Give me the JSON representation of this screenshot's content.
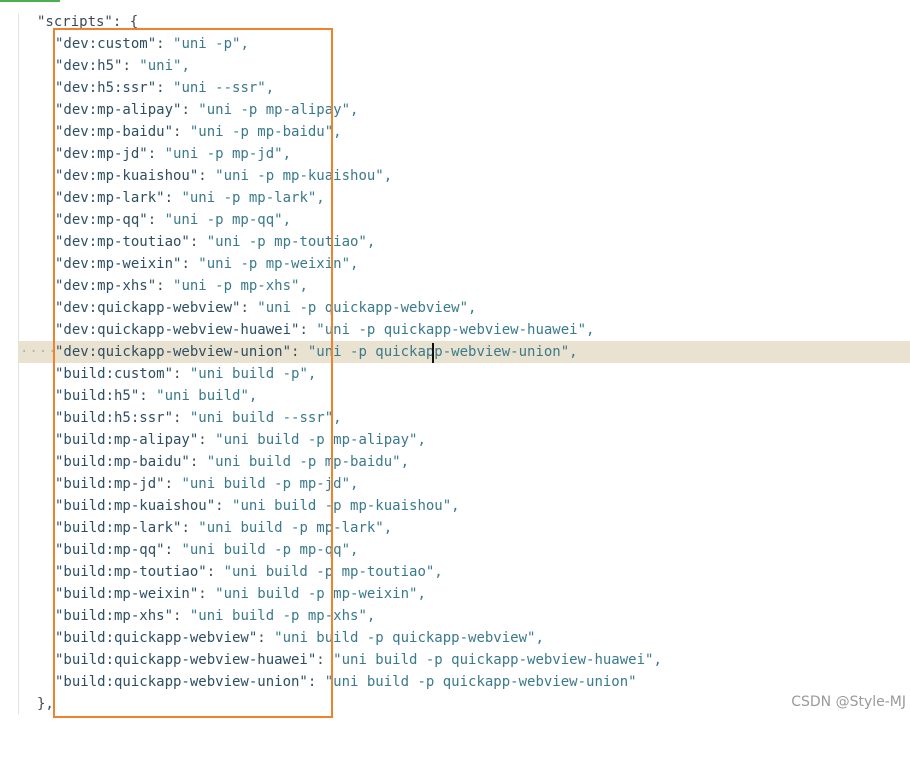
{
  "editor": {
    "open_line": "\"scripts\": {",
    "close_line": "},",
    "whitespace_marker": "····",
    "current_line_index": 14,
    "entries": [
      {
        "key": "\"dev:custom\"",
        "value": "\"uni -p\","
      },
      {
        "key": "\"dev:h5\"",
        "value": "\"uni\","
      },
      {
        "key": "\"dev:h5:ssr\"",
        "value": "\"uni --ssr\","
      },
      {
        "key": "\"dev:mp-alipay\"",
        "value": "\"uni -p mp-alipay\","
      },
      {
        "key": "\"dev:mp-baidu\"",
        "value": "\"uni -p mp-baidu\","
      },
      {
        "key": "\"dev:mp-jd\"",
        "value": "\"uni -p mp-jd\","
      },
      {
        "key": "\"dev:mp-kuaishou\"",
        "value": "\"uni -p mp-kuaishou\","
      },
      {
        "key": "\"dev:mp-lark\"",
        "value": "\"uni -p mp-lark\","
      },
      {
        "key": "\"dev:mp-qq\"",
        "value": "\"uni -p mp-qq\","
      },
      {
        "key": "\"dev:mp-toutiao\"",
        "value": "\"uni -p mp-toutiao\","
      },
      {
        "key": "\"dev:mp-weixin\"",
        "value": "\"uni -p mp-weixin\","
      },
      {
        "key": "\"dev:mp-xhs\"",
        "value": "\"uni -p mp-xhs\","
      },
      {
        "key": "\"dev:quickapp-webview\"",
        "value": "\"uni -p quickapp-webview\","
      },
      {
        "key": "\"dev:quickapp-webview-huawei\"",
        "value": "\"uni -p quickapp-webview-huawei\","
      },
      {
        "key": "\"dev:quickapp-webview-union\"",
        "value": "\"uni -p quickapp-webview-union\","
      },
      {
        "key": "\"build:custom\"",
        "value": "\"uni build -p\","
      },
      {
        "key": "\"build:h5\"",
        "value": "\"uni build\","
      },
      {
        "key": "\"build:h5:ssr\"",
        "value": "\"uni build --ssr\","
      },
      {
        "key": "\"build:mp-alipay\"",
        "value": "\"uni build -p mp-alipay\","
      },
      {
        "key": "\"build:mp-baidu\"",
        "value": "\"uni build -p mp-baidu\","
      },
      {
        "key": "\"build:mp-jd\"",
        "value": "\"uni build -p mp-jd\","
      },
      {
        "key": "\"build:mp-kuaishou\"",
        "value": "\"uni build -p mp-kuaishou\","
      },
      {
        "key": "\"build:mp-lark\"",
        "value": "\"uni build -p mp-lark\","
      },
      {
        "key": "\"build:mp-qq\"",
        "value": "\"uni build -p mp-qq\","
      },
      {
        "key": "\"build:mp-toutiao\"",
        "value": "\"uni build -p mp-toutiao\","
      },
      {
        "key": "\"build:mp-weixin\"",
        "value": "\"uni build -p mp-weixin\","
      },
      {
        "key": "\"build:mp-xhs\"",
        "value": "\"uni build -p mp-xhs\","
      },
      {
        "key": "\"build:quickapp-webview\"",
        "value": "\"uni build -p quickapp-webview\","
      },
      {
        "key": "\"build:quickapp-webview-huawei\"",
        "value": "\"uni build -p quickapp-webview-huawei\","
      },
      {
        "key": "\"build:quickapp-webview-union\"",
        "value": "\"uni build -p quickapp-webview-union\""
      }
    ]
  },
  "watermark": "CSDN @Style-MJ",
  "colors": {
    "highlight_box": "#f0822e",
    "current_line": "#e9e2d0",
    "key": "#2e4f63",
    "value": "#3a7a8c"
  }
}
